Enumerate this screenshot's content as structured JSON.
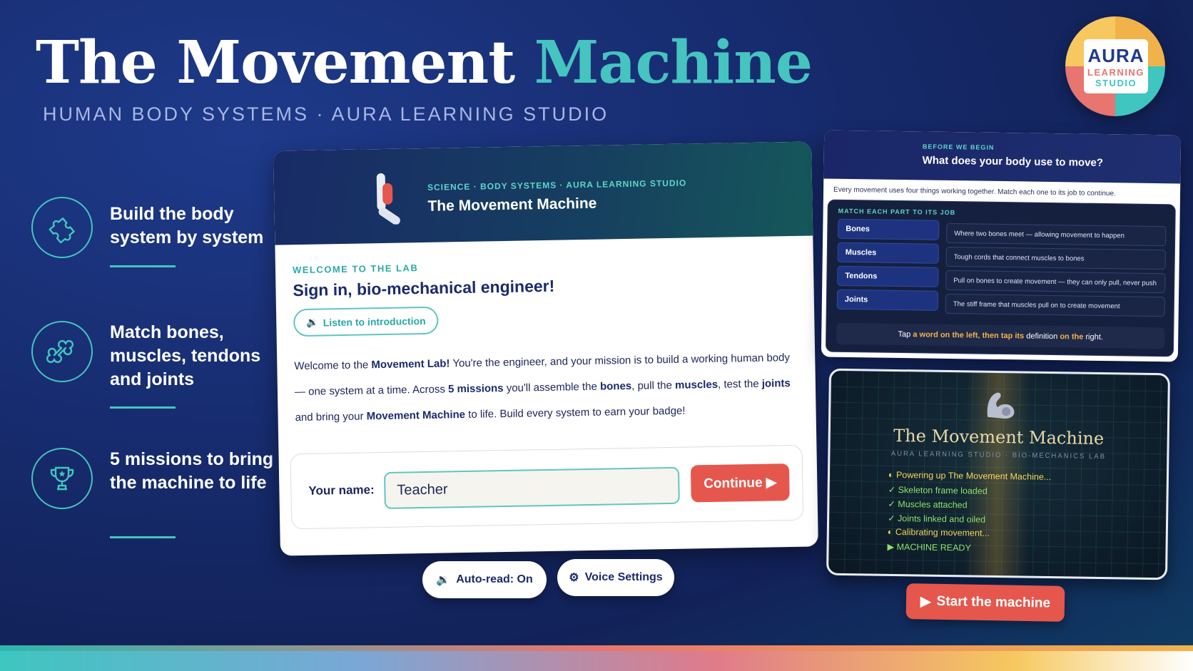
{
  "hero": {
    "title_main": "The Movement ",
    "title_accent": "Machine",
    "subtitle": "HUMAN BODY SYSTEMS · AURA LEARNING STUDIO"
  },
  "logo": {
    "main": "AURA",
    "line2": "LEARNING",
    "line3": "STUDIO"
  },
  "features": [
    {
      "icon": "puzzle-icon",
      "text": "Build the body system by system"
    },
    {
      "icon": "bone-icon",
      "text": "Match bones, muscles, tendons and joints"
    },
    {
      "icon": "trophy-icon",
      "text": "5 missions to bring the machine to life"
    }
  ],
  "main_card": {
    "breadcrumb": "SCIENCE · BODY SYSTEMS · AURA LEARNING STUDIO",
    "title": "The Movement Machine",
    "kicker": "WELCOME TO THE LAB",
    "heading": "Sign in, bio-mechanical engineer!",
    "listen_label": "Listen to introduction",
    "intro": {
      "p1": "Welcome to the ",
      "b1": "Movement Lab!",
      "p2": " You're the engineer, and your mission is to build a working human body — one system at a time. Across ",
      "b2": "5 missions",
      "p3": " you'll assemble the ",
      "b3": "bones",
      "p4": ", pull the ",
      "b4": "muscles",
      "p5": ", test the ",
      "b5": "joints",
      "p6": " and bring your ",
      "b6": "Movement Machine",
      "p7": " to life. Build every system to earn your badge!"
    },
    "name_label": "Your name:",
    "name_value": "Teacher",
    "continue_label": "Continue ▶"
  },
  "controls": {
    "auto_read": "Auto-read: On",
    "voice_settings": "Voice Settings"
  },
  "match_card": {
    "kicker": "BEFORE WE BEGIN",
    "title": "What does your body use to move?",
    "description": "Every movement uses four things working together. Match each one to its job to continue.",
    "panel_kicker": "MATCH EACH PART TO ITS JOB",
    "terms": [
      "Bones",
      "Muscles",
      "Tendons",
      "Joints"
    ],
    "definitions": [
      "Where two bones meet — allowing movement to happen",
      "Tough cords that connect muscles to bones",
      "Pull on bones to create movement — they can only pull, never push",
      "The stiff frame that muscles pull on to create movement"
    ],
    "hint_pre": "Tap ",
    "hint_1": "a word on the left",
    "hint_mid": ", ",
    "hint_2": "then tap its",
    "hint_mid2": " definition ",
    "hint_3": "on the",
    "hint_post": " right."
  },
  "loading_card": {
    "title": "The Movement Machine",
    "subtitle": "AURA LEARNING STUDIO · BIO-MECHANICS LAB",
    "status": [
      {
        "mark": "◐",
        "text": "Powering up The Movement Machine...",
        "tone": "yellow"
      },
      {
        "mark": "✓",
        "text": "Skeleton frame loaded",
        "tone": "green"
      },
      {
        "mark": "✓",
        "text": "Muscles attached",
        "tone": "green"
      },
      {
        "mark": "✓",
        "text": "Joints linked and oiled",
        "tone": "green"
      },
      {
        "mark": "◐",
        "text": "Calibrating movement...",
        "tone": "yellow"
      },
      {
        "mark": "▶",
        "text": "MACHINE READY",
        "tone": "green"
      }
    ]
  },
  "start_label": "Start the machine",
  "colors": {
    "accent_teal": "#45c4c0",
    "brand_navy": "#1b2a6b",
    "cta_red": "#e5574d"
  }
}
